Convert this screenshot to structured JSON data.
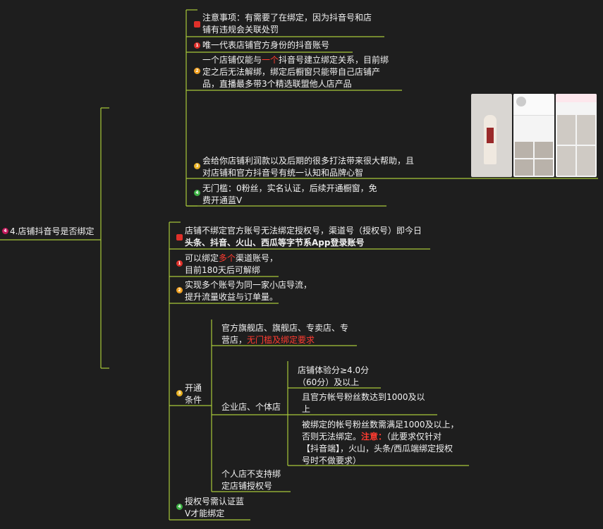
{
  "root": {
    "icon": "4",
    "label": "4.店铺抖音号是否绑定"
  },
  "top_branch": {
    "note": {
      "line1": "注意事项：有需要了在绑定，因为抖音号和店",
      "line2": "铺有违规会关联处罚"
    },
    "n1": {
      "icon": "1",
      "text": "唯一代表店铺官方身份的抖音账号"
    },
    "n2": {
      "icon": "2",
      "line1_a": "一个店铺仅能与",
      "line1_red": "一个",
      "line1_b": "抖音号建立绑定关系，目前绑",
      "line2": "定之后无法解绑，绑定后橱窗只能带自己店铺产",
      "line3": "品，直播最多带3个精选联盟他人店产品"
    },
    "n3": {
      "icon": "3",
      "line1": "会给你店铺利润款以及后期的很多打法带来很大帮助，且",
      "line2": "对店铺和官方抖音号有统一认知和品牌心智"
    },
    "n4": {
      "icon": "4",
      "line1": "无门槛：0粉丝，实名认证，后续开通橱窗，免",
      "line2": "费开通蓝V"
    }
  },
  "bottom_branch": {
    "note": {
      "line1": "店铺不绑定官方账号无法绑定授权号，渠道号（授权号）即今日",
      "line2": "头条、抖音、火山、西瓜等字节系App登录账号"
    },
    "n1": {
      "icon": "1",
      "line1_a": "可以绑定",
      "line1_red": "多个",
      "line1_b": "渠道账号，",
      "line2": "目前180天后可解绑"
    },
    "n2": {
      "icon": "2",
      "line1": "实现多个账号为同一家小店导流，",
      "line2": "提升流量收益与订单量。"
    },
    "n3": {
      "icon": "3",
      "line1": "开通",
      "line2": "条件"
    },
    "n4": {
      "icon": "4",
      "line1": "授权号需认证蓝",
      "line2": "V才能绑定"
    }
  },
  "conditions": {
    "c1": {
      "line1": "官方旗舰店、旗舰店、专卖店、专",
      "line2_a": "营店，",
      "line2_red": "无门槛及绑定要求"
    },
    "c2": {
      "label": "企业店、个体店"
    },
    "c3": {
      "line1": "个人店不支持绑",
      "line2": "定店铺授权号"
    }
  },
  "enterprise": {
    "e1": {
      "line1": "店铺体验分≥4.0分",
      "line2": "（60分）及以上"
    },
    "e2": {
      "line1": "且官方帐号粉丝数达到1000及以",
      "line2": "上"
    },
    "e3": {
      "line1": "被绑定的帐号粉丝数需满足1000及以上，",
      "line2_a": "否则无法绑定。",
      "line2_red": "注意：",
      "line2_b": "（此要求仅针对",
      "line3": "【抖音端】，火山，头条/西瓜端绑定授权",
      "line4": "号时不做要求）"
    }
  },
  "colors": {
    "bg": "#1e1e1e",
    "line": "#a8c83a",
    "text": "#f2f2f2",
    "red": "#ff3b30"
  }
}
